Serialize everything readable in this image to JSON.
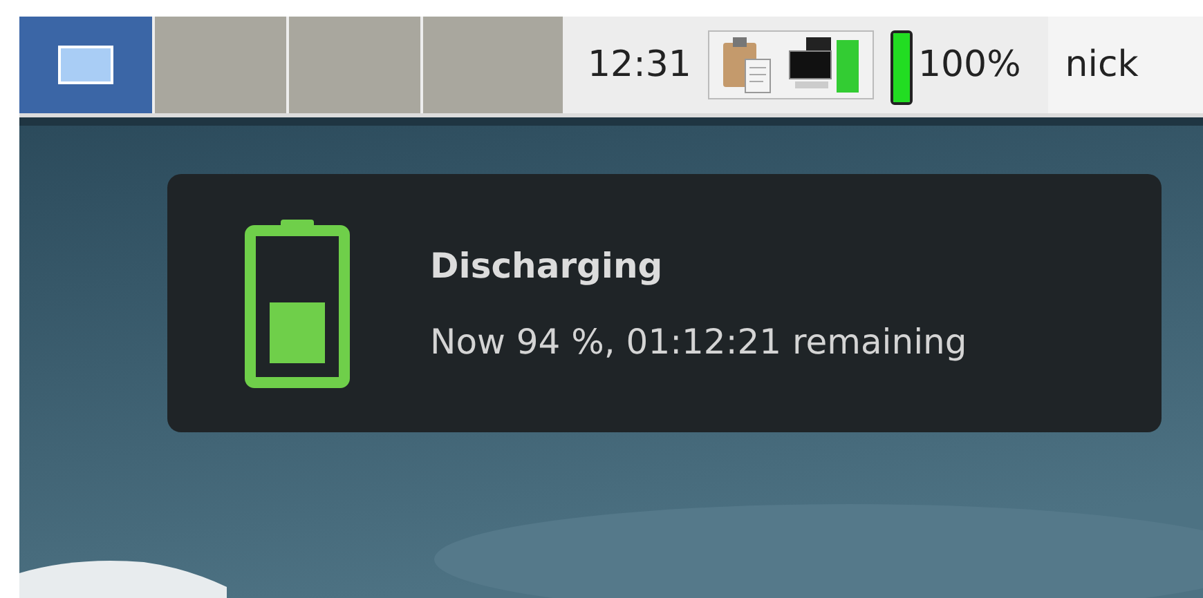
{
  "taskbar": {
    "window_buttons": [
      {
        "selected": true
      },
      {
        "selected": false
      },
      {
        "selected": false
      },
      {
        "selected": false
      }
    ],
    "clock": "12:31",
    "battery": {
      "level": 1,
      "reading": "100%"
    },
    "user": "nick"
  },
  "notification": {
    "title": "Discharging",
    "body": "Now 94 %, 01:12:21 remaining"
  }
}
